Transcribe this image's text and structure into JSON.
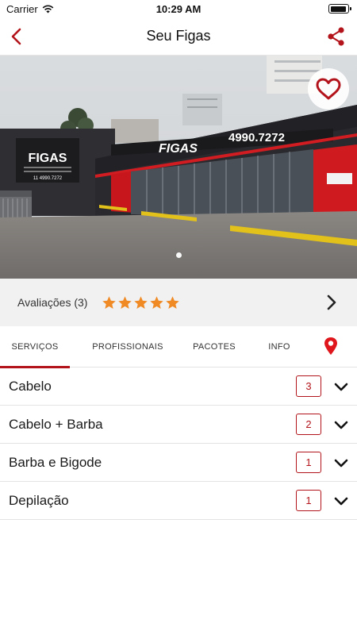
{
  "status_bar": {
    "carrier": "Carrier",
    "time": "10:29 AM",
    "battery_level": 0.95
  },
  "nav": {
    "title": "Seu Figas"
  },
  "hero": {
    "sign_name": "FIGAS",
    "sign_phone": "4990.7272",
    "billboard_name": "FIGAS",
    "billboard_phone": "11 4990.7272",
    "pager": {
      "count": 1,
      "active": 0
    }
  },
  "rating": {
    "label": "Avaliações (3)",
    "stars": 5
  },
  "tabs": [
    {
      "label": "SERVIÇOS",
      "active": true
    },
    {
      "label": "PROFISSIONAIS",
      "active": false
    },
    {
      "label": "PACOTES",
      "active": false
    },
    {
      "label": "INFO",
      "active": false
    }
  ],
  "services": [
    {
      "name": "Cabelo",
      "count": "3"
    },
    {
      "name": "Cabelo + Barba",
      "count": "2"
    },
    {
      "name": "Barba e Bigode",
      "count": "1"
    },
    {
      "name": "Depilação",
      "count": "1"
    }
  ],
  "colors": {
    "accent": "#b3141b",
    "star": "#f08a24",
    "rating_bg": "#f1f1f1"
  }
}
